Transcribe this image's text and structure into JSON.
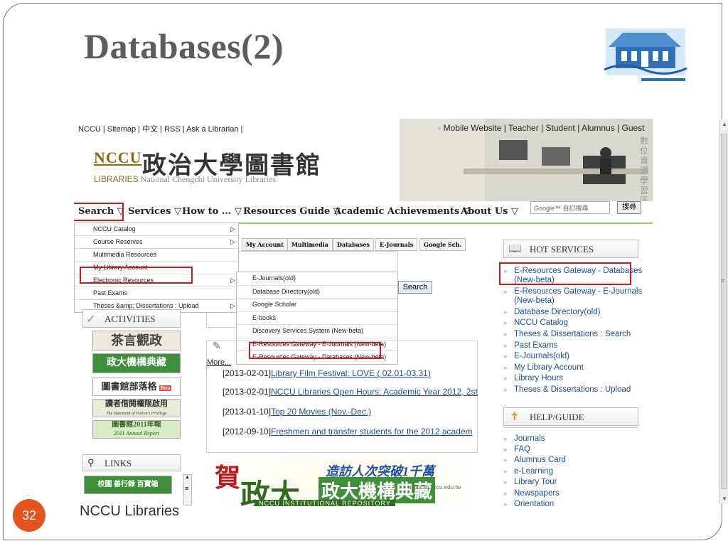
{
  "slide": {
    "title": "Databases(2)",
    "page_number": "32",
    "footer": "NCCU Libraries"
  },
  "site": {
    "top_links_left": [
      "NCCU",
      "Sitemap",
      "中文",
      "RSS",
      "Ask a Librarian"
    ],
    "top_links_right": [
      "Mobile Website",
      "Teacher",
      "Student",
      "Alumnus",
      "Guest"
    ],
    "logo": {
      "abbr": "NCCU",
      "abbr_sub": "LIBRARIES",
      "name_zh": "政治大學圖書館",
      "name_en": "National Chengchi University Libraries"
    },
    "vertical_zh": "數位資源學習區",
    "nav": [
      "Search",
      "Services",
      "How to ...",
      "Resources Guide",
      "Academic Achievements",
      "About Us"
    ],
    "search_placeholder": "Google™ 自訂搜尋",
    "search_button": "搜尋"
  },
  "search_menu": [
    {
      "label": "NCCU Catalog",
      "has_sub": true
    },
    {
      "label": "Course Reserves",
      "has_sub": true
    },
    {
      "label": "Multimedia Resources",
      "has_sub": false
    },
    {
      "label": "My Library Account",
      "has_sub": false
    },
    {
      "label": "Electronic Resources",
      "has_sub": true
    },
    {
      "label": "Past Exams",
      "has_sub": false
    },
    {
      "label": "Theses &amp; Dissertations : Upload",
      "has_sub": true
    }
  ],
  "electronic_submenu": [
    "E-Journals(old)",
    "Database Directory(old)",
    "Google Scholar",
    "E-books",
    "Discovery Services System (New-beta)",
    "E-Resources Gateway - E-Journals (New-beta)",
    "E-Resources Gateway - Databases (New-beta)"
  ],
  "tabs": [
    "My Account",
    "Multimedia",
    "Databases",
    "E-Journals",
    "Google Sch."
  ],
  "search_go": "Search",
  "activities": {
    "title": "ACTIVITIES",
    "banners": [
      "茶言觀政",
      "政大機構典藏",
      "圖書館部落格",
      "讀者借閱權限啟用",
      "圖書館2011年報"
    ],
    "banner_subs": [
      "The Statement of Patron's Privilege",
      "2011 Annual Report"
    ],
    "beta": "Beta"
  },
  "links": {
    "title": "LINKS",
    "banner": "校園 善行錄 百寶箱"
  },
  "news": {
    "more": "More...",
    "items": [
      {
        "date": "[2013-02-01]",
        "text": "Library Film Festival: LOVE ( 02.01-03.31)"
      },
      {
        "date": "[2013-02-01]",
        "text": "NCCU Libraries Open Hours: Academic Year 2012, 2st"
      },
      {
        "date": "[2013-01-10]",
        "text": "Top 20 Movies (Nov.-Dec.)"
      },
      {
        "date": "[2012-09-10]",
        "text": "Freshmen and transfer students for the 2012 academ"
      }
    ]
  },
  "ir_banner": {
    "heading_zh": "造訪人次突破1千萬",
    "char_he": "賀",
    "brand_zh": "政大機構典藏",
    "url": "nccur.lib.nccu.edu.tw",
    "sub_en": "NCCU INSTITUTIONAL REPOSITORY"
  },
  "hot_services": {
    "title": "HOT SERVICES",
    "items": [
      "E-Resources Gateway - Databases (New-beta)",
      "E-Resources Gateway - E-Journals (New-beta)",
      "Database Directory(old)",
      "NCCU Catalog",
      "Theses & Dissertations : Search",
      "Past Exams",
      "E-Journals(old)",
      "My Library Account",
      "Library Hours",
      "Theses & Dissertations : Upload"
    ]
  },
  "help": {
    "title": "HELP/GUIDE",
    "items": [
      "Journals",
      "FAQ",
      "Alumnus Card",
      "e-Learning",
      "Library Tour",
      "Newspapers",
      "Orientation"
    ]
  },
  "colors": {
    "highlight": "#d9141b",
    "link": "#1a4fa0",
    "page_badge": "#e3541e",
    "nav_rule": "#9cc36a"
  }
}
